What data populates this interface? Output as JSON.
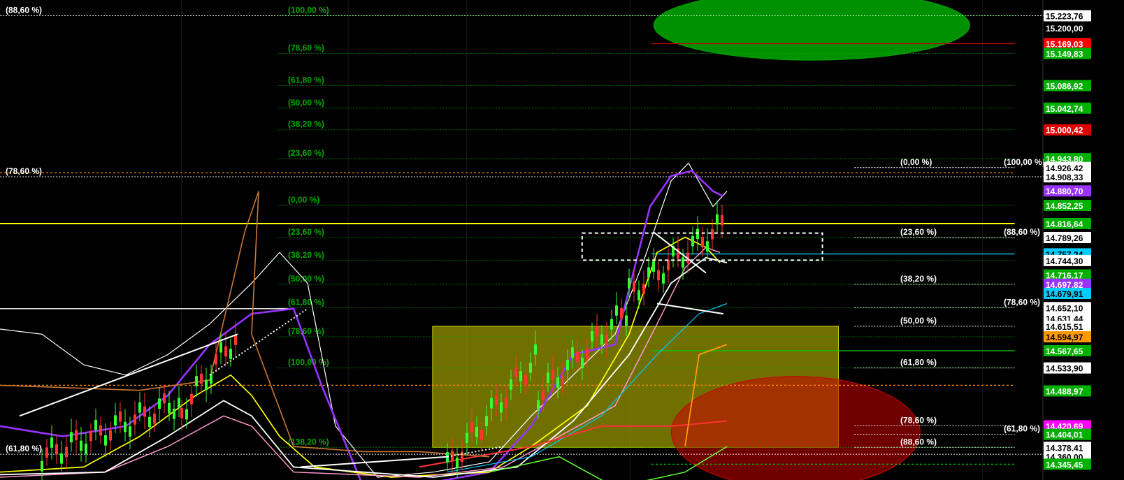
{
  "app": {
    "title": ""
  },
  "chart_data": {
    "type": "line",
    "title": "",
    "xlabel": "",
    "ylabel": "",
    "ylim": [
      14300,
      15250
    ],
    "grid": false,
    "legend": "none",
    "price_axis_labels": [
      {
        "value": 15223.76,
        "text": "15.223,76",
        "bg": "#ffffff",
        "fg": "#000000"
      },
      {
        "value": 15200.0,
        "text": "15.200,00",
        "bg": "#000000",
        "fg": "#ffffff"
      },
      {
        "value": 15169.03,
        "text": "15.169,03",
        "bg": "#ff0000",
        "fg": "#ffffff"
      },
      {
        "value": 15149.83,
        "text": "15.149,83",
        "bg": "#00b000",
        "fg": "#ffffff"
      },
      {
        "value": 15086.92,
        "text": "15.086,92",
        "bg": "#00b000",
        "fg": "#ffffff"
      },
      {
        "value": 15042.74,
        "text": "15.042,74",
        "bg": "#00b000",
        "fg": "#ffffff"
      },
      {
        "value": 15000.42,
        "text": "15.000,42",
        "bg": "#e00000",
        "fg": "#ffffff"
      },
      {
        "value": 14943.8,
        "text": "14.943,80",
        "bg": "#00b000",
        "fg": "#ffffff"
      },
      {
        "value": 14926.42,
        "text": "14.926,42",
        "bg": "#ffffff",
        "fg": "#000000"
      },
      {
        "value": 14908.33,
        "text": "14.908,33",
        "bg": "#ffffff",
        "fg": "#000000"
      },
      {
        "value": 14880.7,
        "text": "14.880,70",
        "bg": "#9933ff",
        "fg": "#ffffff"
      },
      {
        "value": 14852.25,
        "text": "14.852,25",
        "bg": "#00b000",
        "fg": "#ffffff"
      },
      {
        "value": 14816.64,
        "text": "14.816,64",
        "bg": "#00b000",
        "fg": "#ffffff"
      },
      {
        "value": 14789.26,
        "text": "14.789,26",
        "bg": "#ffffff",
        "fg": "#000000"
      },
      {
        "value": 14757.24,
        "text": "14.757,24",
        "bg": "#00ccff",
        "fg": "#000000"
      },
      {
        "value": 14744.3,
        "text": "14.744,30",
        "bg": "#ffffff",
        "fg": "#000000"
      },
      {
        "value": 14716.17,
        "text": "14.716,17",
        "bg": "#00b000",
        "fg": "#ffffff"
      },
      {
        "value": 14697.82,
        "text": "14.697,82",
        "bg": "#9933ff",
        "fg": "#ffffff"
      },
      {
        "value": 14679.91,
        "text": "14.679,91",
        "bg": "#00ccff",
        "fg": "#000000"
      },
      {
        "value": 14652.1,
        "text": "14.652,10",
        "bg": "#ffffff",
        "fg": "#000000"
      },
      {
        "value": 14631.44,
        "text": "14.631,44",
        "bg": "#ffffff",
        "fg": "#000000"
      },
      {
        "value": 14615.51,
        "text": "14.615,51",
        "bg": "#ffffff",
        "fg": "#000000"
      },
      {
        "value": 14594.97,
        "text": "14.594,97",
        "bg": "#ff9900",
        "fg": "#000000"
      },
      {
        "value": 14567.65,
        "text": "14.567,65",
        "bg": "#00b000",
        "fg": "#ffffff"
      },
      {
        "value": 14533.9,
        "text": "14.533,90",
        "bg": "#ffffff",
        "fg": "#000000"
      },
      {
        "value": 14488.97,
        "text": "14.488,97",
        "bg": "#00b000",
        "fg": "#ffffff"
      },
      {
        "value": 14420.69,
        "text": "14.420,69",
        "bg": "#ff00ff",
        "fg": "#ffffff"
      },
      {
        "value": 14404.01,
        "text": "14.404,01",
        "bg": "#00b000",
        "fg": "#ffffff"
      },
      {
        "value": 14378.41,
        "text": "14.378,41",
        "bg": "#ffffff",
        "fg": "#000000"
      },
      {
        "value": 14360.0,
        "text": "14.360,00",
        "bg": "#ffffff",
        "fg": "#000000"
      },
      {
        "value": 14345.45,
        "text": "14.345,45",
        "bg": "#00b000",
        "fg": "#ffffff"
      }
    ],
    "fib_levels": [
      {
        "text": "(88,60 %)",
        "value": 15223.76,
        "color": "#ffffff",
        "group": "left-white",
        "x_from": 0.0,
        "x_to": 1.0
      },
      {
        "text": "(78,60 %)",
        "value": 14908.33,
        "color": "#ffffff",
        "group": "left-white",
        "x_from": 0.0,
        "x_to": 1.0
      },
      {
        "text": "(61,80 %)",
        "value": 14365.0,
        "color": "#ffffff",
        "group": "left-white",
        "x_from": 0.0,
        "x_to": 1.0
      },
      {
        "text": "(100,00 %)",
        "value": 15223.76,
        "color": "#00aa00",
        "group": "green",
        "x_from": 0.26,
        "x_to": 0.95
      },
      {
        "text": "(78,60 %)",
        "value": 15149.83,
        "color": "#00aa00",
        "group": "green",
        "x_from": 0.26,
        "x_to": 0.95
      },
      {
        "text": "(61,80 %)",
        "value": 15086.92,
        "color": "#00aa00",
        "group": "green",
        "x_from": 0.26,
        "x_to": 0.95
      },
      {
        "text": "(50,00 %)",
        "value": 15042.74,
        "color": "#00aa00",
        "group": "green",
        "x_from": 0.26,
        "x_to": 0.95
      },
      {
        "text": "(38,20 %)",
        "value": 15000.42,
        "color": "#00aa00",
        "group": "green",
        "x_from": 0.26,
        "x_to": 0.95
      },
      {
        "text": "(23,60 %)",
        "value": 14943.8,
        "color": "#00aa00",
        "group": "green",
        "x_from": 0.26,
        "x_to": 0.95
      },
      {
        "text": "(0,00 %)",
        "value": 14852.25,
        "color": "#00aa00",
        "group": "green",
        "x_from": 0.26,
        "x_to": 0.95
      },
      {
        "text": "(23,60 %)",
        "value": 14789.26,
        "color": "#00aa00",
        "group": "green",
        "x_from": 0.26,
        "x_to": 0.95
      },
      {
        "text": "(38,20 %)",
        "value": 14744.3,
        "color": "#00aa00",
        "group": "green",
        "x_from": 0.26,
        "x_to": 0.95
      },
      {
        "text": "(50,00 %)",
        "value": 14697.82,
        "color": "#00aa00",
        "group": "green",
        "x_from": 0.26,
        "x_to": 0.95
      },
      {
        "text": "(61,80 %)",
        "value": 14652.1,
        "color": "#00aa00",
        "group": "green",
        "x_from": 0.26,
        "x_to": 0.95
      },
      {
        "text": "(78,60 %)",
        "value": 14594.97,
        "color": "#00aa00",
        "group": "green",
        "x_from": 0.26,
        "x_to": 0.95
      },
      {
        "text": "(100,00 %)",
        "value": 14533.9,
        "color": "#00aa00",
        "group": "green",
        "x_from": 0.26,
        "x_to": 0.95
      },
      {
        "text": "(138,20 %)",
        "value": 14378.41,
        "color": "#00aa00",
        "group": "green",
        "x_from": 0.26,
        "x_to": 0.95
      },
      {
        "text": "(0,00 %)",
        "value": 14926.42,
        "color": "#ffffff",
        "group": "right-white",
        "x_from": 0.8,
        "x_to": 0.95
      },
      {
        "text": "(23,60 %)",
        "value": 14789.26,
        "color": "#ffffff",
        "group": "right-white",
        "x_from": 0.8,
        "x_to": 0.95
      },
      {
        "text": "(38,20 %)",
        "value": 14697.82,
        "color": "#ffffff",
        "group": "right-white",
        "x_from": 0.8,
        "x_to": 0.95
      },
      {
        "text": "(50,00 %)",
        "value": 14615.51,
        "color": "#ffffff",
        "group": "right-white",
        "x_from": 0.8,
        "x_to": 0.95
      },
      {
        "text": "(61,80 %)",
        "value": 14533.9,
        "color": "#ffffff",
        "group": "right-white",
        "x_from": 0.8,
        "x_to": 0.95
      },
      {
        "text": "(78,60 %)",
        "value": 14420.69,
        "color": "#ffffff",
        "group": "right-white",
        "x_from": 0.8,
        "x_to": 0.95
      },
      {
        "text": "(88,60 %)",
        "value": 14378.41,
        "color": "#ffffff",
        "group": "right-white",
        "x_from": 0.8,
        "x_to": 0.95
      },
      {
        "text": "(100,00 %)",
        "value": 14926.42,
        "color": "#ffffff",
        "group": "far-right-white",
        "x_from": 0.8,
        "x_to": 0.95
      },
      {
        "text": "(88,60 %)",
        "value": 14789.26,
        "color": "#ffffff",
        "group": "far-right-white",
        "x_from": 0.8,
        "x_to": 0.95
      },
      {
        "text": "(78,60 %)",
        "value": 14652.1,
        "color": "#ffffff",
        "group": "far-right-white",
        "x_from": 0.8,
        "x_to": 0.95
      },
      {
        "text": "(61,80 %)",
        "value": 14404.01,
        "color": "#ffffff",
        "group": "far-right-white",
        "x_from": 0.8,
        "x_to": 0.95
      }
    ],
    "horizontal_lines": [
      {
        "value": 14816.64,
        "color": "#ffff00",
        "style": "solid",
        "x_from": 0.0,
        "x_to": 0.95
      },
      {
        "value": 15169.03,
        "color": "#cc0000",
        "style": "solid",
        "x_from": 0.61,
        "x_to": 0.95
      },
      {
        "value": 14757.24,
        "color": "#00ccff",
        "style": "solid",
        "x_from": 0.61,
        "x_to": 0.95
      },
      {
        "value": 14567.65,
        "color": "#00cc00",
        "style": "solid",
        "x_from": 0.61,
        "x_to": 0.95
      },
      {
        "value": 14500.0,
        "color": "#ff8800",
        "style": "dashed",
        "x_from": 0.0,
        "x_to": 0.95
      },
      {
        "value": 14916.0,
        "color": "#ff8800",
        "style": "dashed",
        "x_from": 0.0,
        "x_to": 0.95
      },
      {
        "value": 14650.0,
        "color": "#ffffff",
        "style": "solid",
        "x_from": 0.0,
        "x_to": 0.27
      },
      {
        "value": 14345.45,
        "color": "#00cc00",
        "style": "dashed",
        "x_from": 0.61,
        "x_to": 0.95
      }
    ],
    "zones": [
      {
        "type": "rect",
        "from_x": 0.405,
        "to_x": 0.785,
        "from_y": 14615.51,
        "to_y": 14378.41,
        "color": "#cccc00"
      },
      {
        "type": "ellipse",
        "center_x": 0.76,
        "center_y": 15205,
        "color": "#00aa00"
      },
      {
        "type": "ellipse",
        "center_x": 0.745,
        "center_y": 14408,
        "color": "#cc0000"
      }
    ],
    "selection_box": {
      "x_from": 0.545,
      "x_to": 0.77,
      "y_from": 14798,
      "y_to": 14745
    }
  }
}
